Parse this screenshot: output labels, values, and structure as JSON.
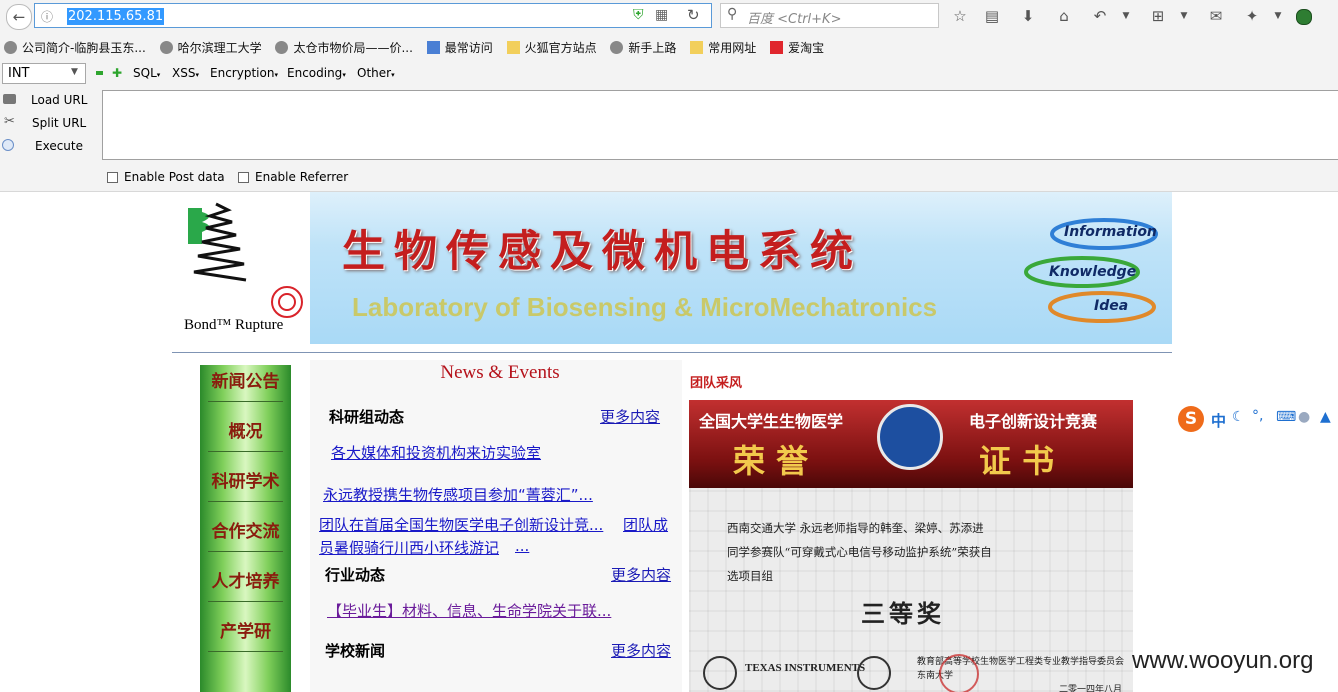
{
  "browser": {
    "url": "202.115.65.81",
    "search_placeholder": "百度 <Ctrl+K>"
  },
  "bookmarks": [
    {
      "label": "公司简介-临朐县玉东...",
      "icon": "globe-icon"
    },
    {
      "label": "哈尔滨理工大学",
      "icon": "globe-icon"
    },
    {
      "label": "太仓市物价局——价...",
      "icon": "globe-icon"
    },
    {
      "label": "最常访问",
      "icon": "bookmark-folder-icon"
    },
    {
      "label": "火狐官方站点",
      "icon": "folder-icon"
    },
    {
      "label": "新手上路",
      "icon": "globe-icon"
    },
    {
      "label": "常用网址",
      "icon": "folder-icon"
    },
    {
      "label": "爱淘宝",
      "icon": "taobao-icon"
    }
  ],
  "hackbar": {
    "select_value": "INT",
    "menus": [
      "SQL",
      "XSS",
      "Encryption",
      "Encoding",
      "Other"
    ],
    "actions": [
      "Load URL",
      "Split URL",
      "Execute"
    ],
    "checkboxes": [
      "Enable Post data",
      "Enable Referrer"
    ]
  },
  "banner": {
    "title_zh": "生物传感及微机电系统",
    "title_en": "Laboratory of Biosensing & MicroMechatronics",
    "logo_text": "Bond™ Rupture",
    "tags": [
      "Information",
      "Knowledge",
      "Idea"
    ]
  },
  "nav": [
    "新闻公告",
    "概况",
    "科研学术",
    "合作交流",
    "人才培养",
    "产学研"
  ],
  "news": {
    "title": "News & Events",
    "sections": [
      {
        "heading": "科研组动态",
        "more": "更多内容"
      },
      {
        "heading": "行业动态",
        "more": "更多内容"
      },
      {
        "heading": "学校新闻",
        "more": "更多内容"
      }
    ],
    "links": [
      "各大媒体和投资机构来访实验室",
      "永远教授携生物传感项目参加“菁蓉汇”...",
      "团队在首届全国生物医学电子创新设计竞...",
      "团队成",
      "员暑假骑行川西小环线游记",
      "...",
      "【毕业生】材料、信息、生命学院关于联..."
    ]
  },
  "team": {
    "title": "团队采风",
    "cert": {
      "left_header": "全国大学生生物医学",
      "right_header": "电子创新设计竞赛",
      "honor_left": "荣  誉",
      "honor_right": "证  书",
      "line1": "西南交通大学      永远老师指导的韩奎、梁婷、苏添进",
      "line2": "同学参赛队“可穿戴式心电信号移动监护系统”荣获自",
      "line3": "选项目组",
      "award": "三等奖",
      "issuer1": "教育部高等学校生物医学工程类专业教学指导委员会",
      "issuer2": "东南大学",
      "date": "二零一四年八月",
      "sponsor": "TEXAS INSTRUMENTS"
    }
  },
  "ime": {
    "label": "中"
  },
  "watermark": "www.wooyun.org"
}
